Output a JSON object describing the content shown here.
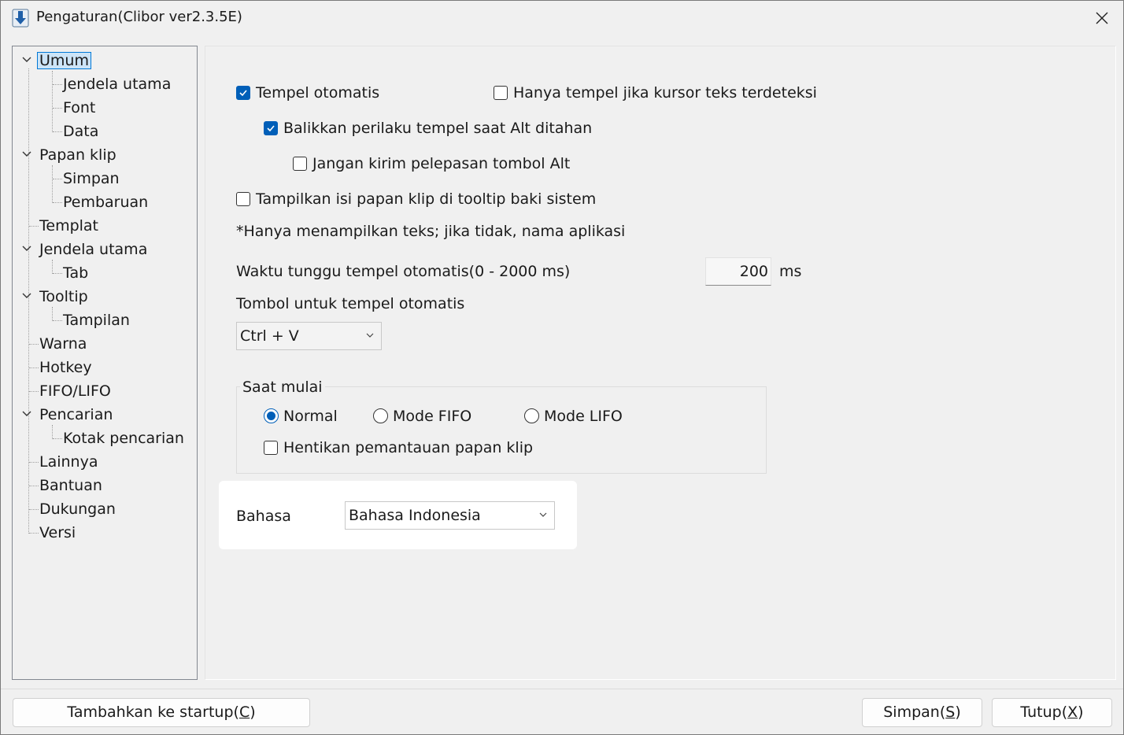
{
  "window": {
    "title": "Pengaturan(Clibor ver2.3.5E)"
  },
  "tree": {
    "items": [
      {
        "label": "Umum"
      },
      {
        "label": "Jendela utama"
      },
      {
        "label": "Font"
      },
      {
        "label": "Data"
      },
      {
        "label": "Papan klip"
      },
      {
        "label": "Simpan"
      },
      {
        "label": "Pembaruan"
      },
      {
        "label": "Templat"
      },
      {
        "label": "Jendela utama"
      },
      {
        "label": "Tab"
      },
      {
        "label": "Tooltip"
      },
      {
        "label": "Tampilan"
      },
      {
        "label": "Warna"
      },
      {
        "label": "Hotkey"
      },
      {
        "label": "FIFO/LIFO"
      },
      {
        "label": "Pencarian"
      },
      {
        "label": "Kotak pencarian"
      },
      {
        "label": "Lainnya"
      },
      {
        "label": "Bantuan"
      },
      {
        "label": "Dukungan"
      },
      {
        "label": "Versi"
      }
    ],
    "selected": "Umum"
  },
  "general": {
    "auto_paste": {
      "label": "Tempel otomatis",
      "checked": true
    },
    "paste_only_cursor": {
      "label": "Hanya tempel jika kursor teks terdeteksi",
      "checked": false
    },
    "reverse_alt": {
      "label": "Balikkan perilaku tempel saat Alt ditahan",
      "checked": true
    },
    "no_alt_release": {
      "label": "Jangan kirim pelepasan tombol Alt",
      "checked": false
    },
    "tray_tooltip": {
      "label": "Tampilkan isi papan klip di tooltip baki sistem",
      "checked": false
    },
    "note": "*Hanya menampilkan teks; jika tidak, nama aplikasi",
    "wait_label": "Waktu tunggu tempel otomatis(0 - 2000 ms)",
    "wait_value": "200",
    "wait_unit": "ms",
    "paste_key_label": "Tombol untuk tempel otomatis",
    "paste_key_value": "Ctrl + V"
  },
  "startup": {
    "caption": "Saat mulai",
    "modes": [
      {
        "label": "Normal",
        "selected": true
      },
      {
        "label": "Mode FIFO",
        "selected": false
      },
      {
        "label": "Mode LIFO",
        "selected": false
      }
    ],
    "stop_monitor": {
      "label": "Hentikan pemantauan papan klip",
      "checked": false
    }
  },
  "language": {
    "label": "Bahasa",
    "value": "Bahasa Indonesia"
  },
  "buttons": {
    "add_startup": {
      "text": "Tambahkan ke startup(",
      "key": "C",
      "end": ")"
    },
    "save": {
      "text": "Simpan(",
      "key": "S",
      "end": ")"
    },
    "close": {
      "text": "Tutup(",
      "key": "X",
      "end": ")"
    }
  },
  "colors": {
    "accent": "#005fb8",
    "selection": "#cce4f7"
  }
}
